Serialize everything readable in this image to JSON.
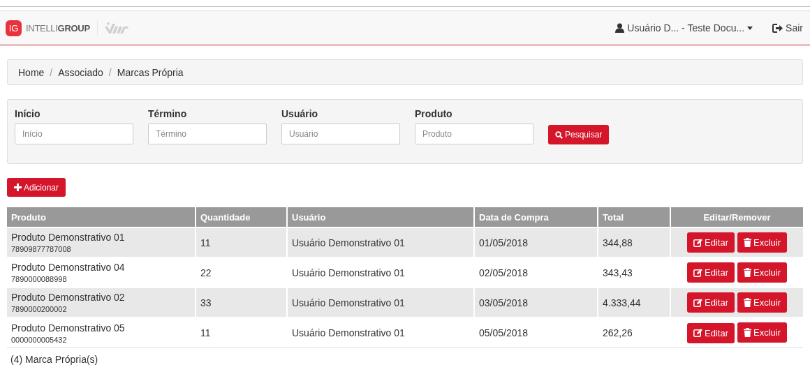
{
  "header": {
    "logo_mark": "IG",
    "logo_text": "INTELLI**GROUP**",
    "user_menu": "Usuário D... - Teste Docu...",
    "logout": "Sair"
  },
  "breadcrumb": [
    "Home",
    "Associado",
    "Marcas Própria"
  ],
  "breadcrumb_separator": "/",
  "filters": [
    {
      "label": "Início",
      "placeholder": "Início"
    },
    {
      "label": "Término",
      "placeholder": "Término"
    },
    {
      "label": "Usuário",
      "placeholder": "Usuário"
    },
    {
      "label": "Produto",
      "placeholder": "Produto"
    }
  ],
  "search_button": "Pesquisar",
  "add_button": "Adicionar",
  "table": {
    "columns": [
      "Produto",
      "Quantidade",
      "Usuário",
      "Data de Compra",
      "Total",
      "Editar/Remover"
    ],
    "rows": [
      {
        "product": "Produto Demonstrativo 01",
        "code": "78909877787008",
        "quantity": "11",
        "user": "Usuário Demonstrativo 01",
        "date": "01/05/2018",
        "total": "344,88",
        "edit": "Editar",
        "remove": "Excluir"
      },
      {
        "product": "Produto Demonstrativo 04",
        "code": "7890000088998",
        "quantity": "22",
        "user": "Usuário Demonstrativo 01",
        "date": "02/05/2018",
        "total": "343,43",
        "edit": "Editar",
        "remove": "Excluir"
      },
      {
        "product": "Produto Demonstrativo 02",
        "code": "7890000200002",
        "quantity": "33",
        "user": "Usuário Demonstrativo 01",
        "date": "03/05/2018",
        "total": "4.333,44",
        "edit": "Editar",
        "remove": "Excluir"
      },
      {
        "product": "Produto Demonstrativo 05",
        "code": "0000000005432",
        "quantity": "11",
        "user": "Usuário Demonstrativo 01",
        "date": "05/05/2018",
        "total": "262,26",
        "edit": "Editar",
        "remove": "Excluir"
      }
    ]
  },
  "footer": "(4) Marca Própria(s)"
}
